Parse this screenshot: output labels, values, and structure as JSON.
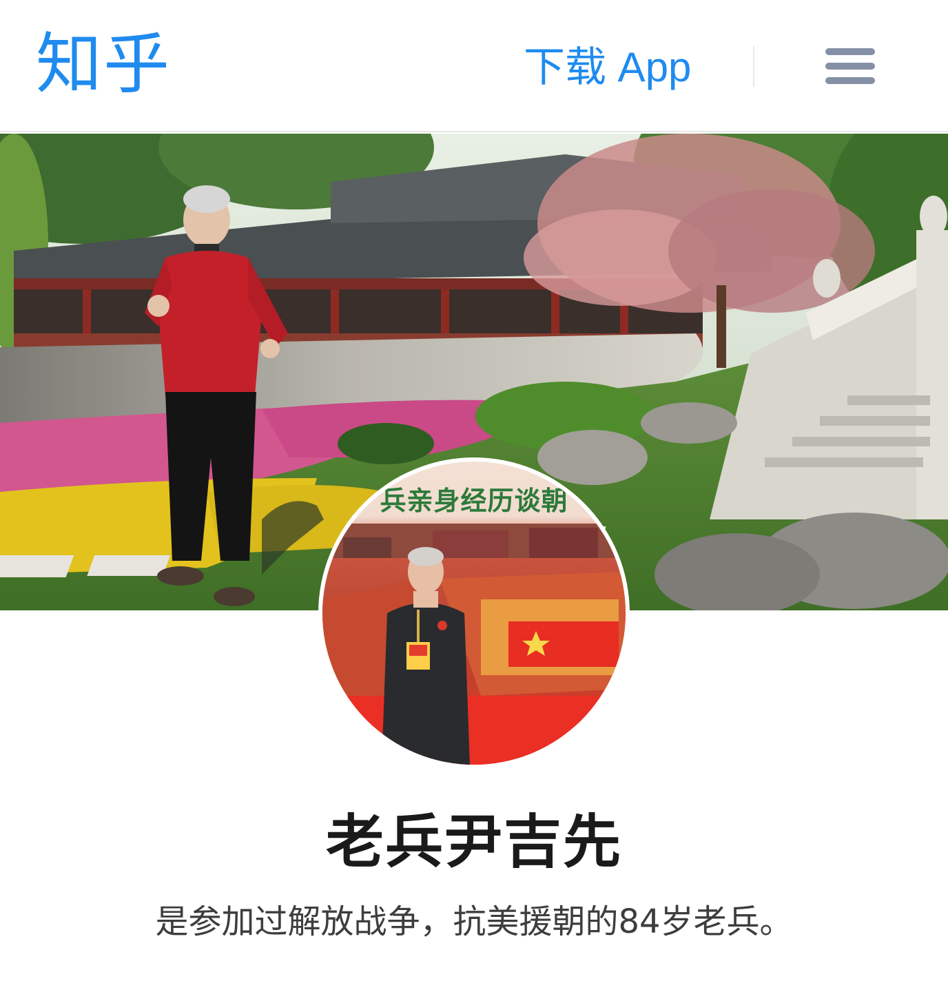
{
  "header": {
    "logo": "知乎",
    "download_app": "下载 App",
    "menu_icon": "hamburger-menu-icon"
  },
  "cover": {
    "description_icon": "cover-photo"
  },
  "avatar": {
    "caption_fragment": "兵亲身经历谈朝"
  },
  "profile": {
    "name": "老兵尹吉先",
    "headline": "是参加过解放战争，抗美援朝的84岁老兵。"
  },
  "colors": {
    "brand": "#1f8bef",
    "menu_icon": "#8590a6",
    "name_text": "#1a1a1a",
    "headline_text": "#3d3d3d"
  }
}
